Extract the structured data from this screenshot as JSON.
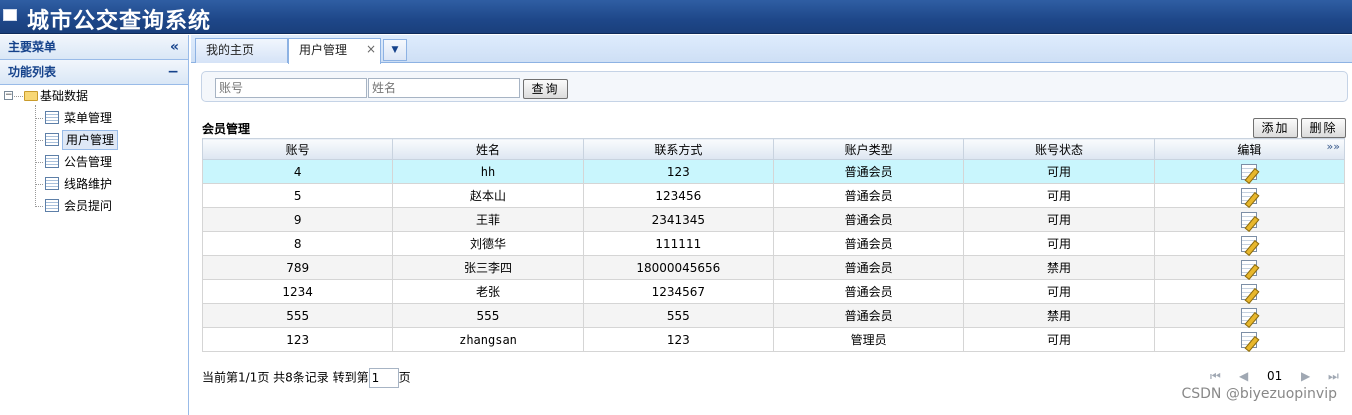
{
  "app": {
    "title": "城市公交查询系统"
  },
  "sidebar": {
    "header": "主要菜单",
    "collapse_icon": "«",
    "section": "功能列表",
    "section_icon": "−",
    "tree": {
      "root": "基础数据",
      "expander": "⊟",
      "items": [
        {
          "label": "菜单管理"
        },
        {
          "label": "用户管理",
          "selected": true
        },
        {
          "label": "公告管理"
        },
        {
          "label": "线路维护"
        },
        {
          "label": "会员提问"
        }
      ]
    }
  },
  "tabs": {
    "items": [
      {
        "label": "我的主页"
      },
      {
        "label": "用户管理",
        "active": true,
        "close": "×"
      }
    ],
    "menu_icon": "▼"
  },
  "search": {
    "account_placeholder": "账号",
    "name_placeholder": "姓名",
    "button": "查询"
  },
  "grid": {
    "title": "会员管理",
    "add_button": "添加",
    "delete_button": "删除",
    "columns": [
      "账号",
      "姓名",
      "联系方式",
      "账户类型",
      "账号状态",
      "编辑"
    ],
    "more_icon": "»»",
    "rows": [
      {
        "account": "4",
        "name": "hh",
        "contact": "123",
        "type": "普通会员",
        "status": "可用"
      },
      {
        "account": "5",
        "name": "赵本山",
        "contact": "123456",
        "type": "普通会员",
        "status": "可用"
      },
      {
        "account": "9",
        "name": "王菲",
        "contact": "2341345",
        "type": "普通会员",
        "status": "可用"
      },
      {
        "account": "8",
        "name": "刘德华",
        "contact": "111111",
        "type": "普通会员",
        "status": "可用"
      },
      {
        "account": "789",
        "name": "张三李四",
        "contact": "18000045656",
        "type": "普通会员",
        "status": "禁用"
      },
      {
        "account": "1234",
        "name": "老张",
        "contact": "1234567",
        "type": "普通会员",
        "status": "可用"
      },
      {
        "account": "555",
        "name": "555",
        "contact": "555",
        "type": "普通会员",
        "status": "禁用"
      },
      {
        "account": "123",
        "name": "zhangsan",
        "contact": "123",
        "type": "管理员",
        "status": "可用"
      }
    ]
  },
  "pager": {
    "summary": "当前第1/1页 共8条记录 转到第",
    "page_value": "1",
    "suffix": "页",
    "first": "⏮",
    "prev": "◀",
    "current": "01",
    "next": "▶",
    "last": "⏭"
  },
  "watermark": "CSDN @biyezuopinvip"
}
